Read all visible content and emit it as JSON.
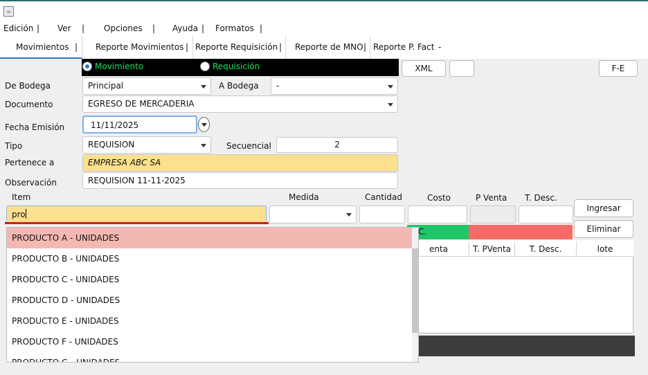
{
  "menu": {
    "items": [
      "Edición",
      "Ver",
      "Opciones",
      "Ayuda",
      "Formatos"
    ],
    "separator": "|"
  },
  "tabs": [
    "Movimientos",
    "Reporte Movimientos",
    "Reporte Requisición",
    "Reporte de MNO",
    "Reporte P. Fact",
    "-"
  ],
  "radios": {
    "movimiento": "Movimiento",
    "requisicion": "Requisición"
  },
  "buttons": {
    "xml": "XML",
    "fe": "F-E",
    "ingresar": "Ingresar",
    "eliminar": "Eliminar"
  },
  "form": {
    "de_bodega_label": "De Bodega",
    "de_bodega_value": "Principal",
    "a_bodega_label": "A Bodega",
    "a_bodega_value": "-",
    "documento_label": "Documento",
    "documento_value": "EGRESO DE MERCADERIA",
    "fecha_label": "Fecha Emisión",
    "fecha_value": "11/11/2025",
    "tipo_label": "Tipo",
    "tipo_value": "REQUISION",
    "secuencial_label": "Secuencial",
    "secuencial_value": "2",
    "pertenece_label": "Pertenece a",
    "pertenece_value": "EMPRESA ABC SA",
    "observacion_label": "Observación",
    "observacion_value": "REQUISION 11-11-2025"
  },
  "item_row": {
    "item_label": "Item",
    "medida_label": "Medida",
    "cantidad_label": "Cantidad",
    "costo_label": "Costo",
    "pventa_label": "P Venta",
    "tdesc_label": "T. Desc.",
    "item_value": "pro",
    "status_text": "C."
  },
  "table": {
    "headers": [
      "enta",
      "T. PVenta",
      "T. Desc.",
      "lote"
    ]
  },
  "dropdown": {
    "items": [
      "PRODUCTO A - UNIDADES",
      "PRODUCTO B - UNIDADES",
      "PRODUCTO C - UNIDADES",
      "PRODUCTO D - UNIDADES",
      "PRODUCTO E - UNIDADES",
      "PRODUCTO F - UNIDADES",
      "PRODUCTO G - UNIDADES"
    ]
  },
  "colors": {
    "accent": "#2e74c9",
    "highlight_field": "#fde08e",
    "dropdown_selected": "#f4b8b3",
    "status_green": "#1fc568",
    "status_red": "#f76b67",
    "radio_text": "#1ee05a",
    "item_underline": "#cc1f1f"
  }
}
